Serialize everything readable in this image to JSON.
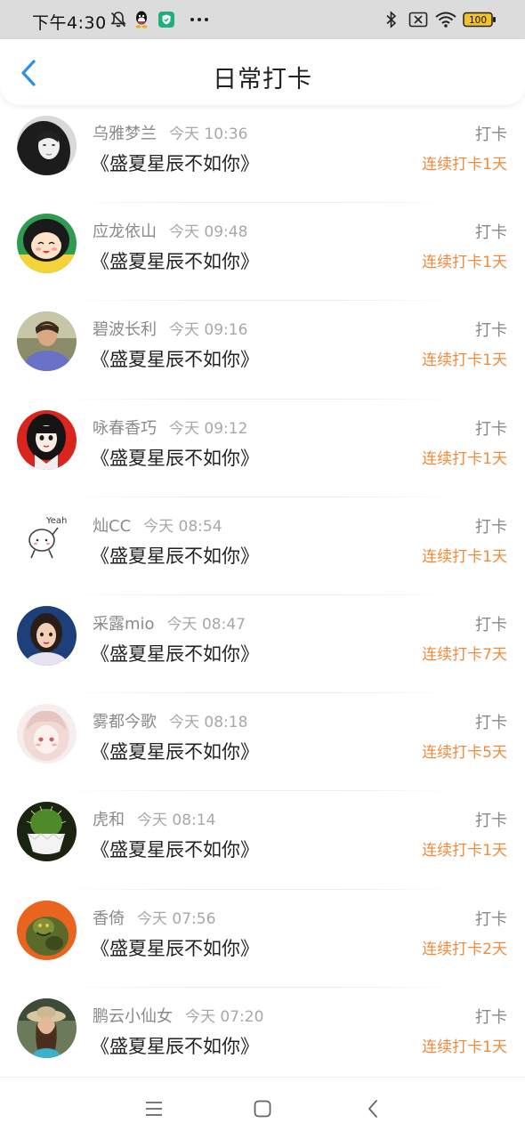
{
  "status_bar": {
    "time": "下午4:30",
    "battery": "100",
    "icons": [
      "bell-muted-icon",
      "qq-icon",
      "shield-app-icon",
      "more-dots-icon",
      "bluetooth-icon",
      "no-sim-icon",
      "wifi-icon",
      "battery-icon"
    ]
  },
  "nav": {
    "title": "日常打卡",
    "back_icon": "chevron-left-icon"
  },
  "colors": {
    "accent": "#2f8fe0",
    "streak": "#f08a3c",
    "status_bar_bg": "#dcdcdc"
  },
  "entries": [
    {
      "name": "乌雅梦兰",
      "time": "今天 10:36",
      "book": "《盛夏星辰不如你》",
      "action": "打卡",
      "streak": "连续打卡1天"
    },
    {
      "name": "应龙依山",
      "time": "今天 09:48",
      "book": "《盛夏星辰不如你》",
      "action": "打卡",
      "streak": "连续打卡1天"
    },
    {
      "name": "碧波长利",
      "time": "今天 09:16",
      "book": "《盛夏星辰不如你》",
      "action": "打卡",
      "streak": "连续打卡1天"
    },
    {
      "name": "咏春香巧",
      "time": "今天 09:12",
      "book": "《盛夏星辰不如你》",
      "action": "打卡",
      "streak": "连续打卡1天"
    },
    {
      "name": "灿CC",
      "time": "今天 08:54",
      "book": "《盛夏星辰不如你》",
      "action": "打卡",
      "streak": "连续打卡1天"
    },
    {
      "name": "采露mio",
      "time": "今天 08:47",
      "book": "《盛夏星辰不如你》",
      "action": "打卡",
      "streak": "连续打卡7天"
    },
    {
      "name": "雾都今歌",
      "time": "今天 08:18",
      "book": "《盛夏星辰不如你》",
      "action": "打卡",
      "streak": "连续打卡5天"
    },
    {
      "name": "虎和",
      "time": "今天 08:14",
      "book": "《盛夏星辰不如你》",
      "action": "打卡",
      "streak": "连续打卡1天"
    },
    {
      "name": "香倚",
      "time": "今天 07:56",
      "book": "《盛夏星辰不如你》",
      "action": "打卡",
      "streak": "连续打卡2天"
    },
    {
      "name": "鹏云小仙女",
      "time": "今天 07:20",
      "book": "《盛夏星辰不如你》",
      "action": "打卡",
      "streak": "连续打卡1天"
    }
  ],
  "avatar_badge_text": "Yeah",
  "bottom_nav": {
    "icons": [
      "menu-icon",
      "home-square-icon",
      "back-arrow-icon"
    ]
  }
}
